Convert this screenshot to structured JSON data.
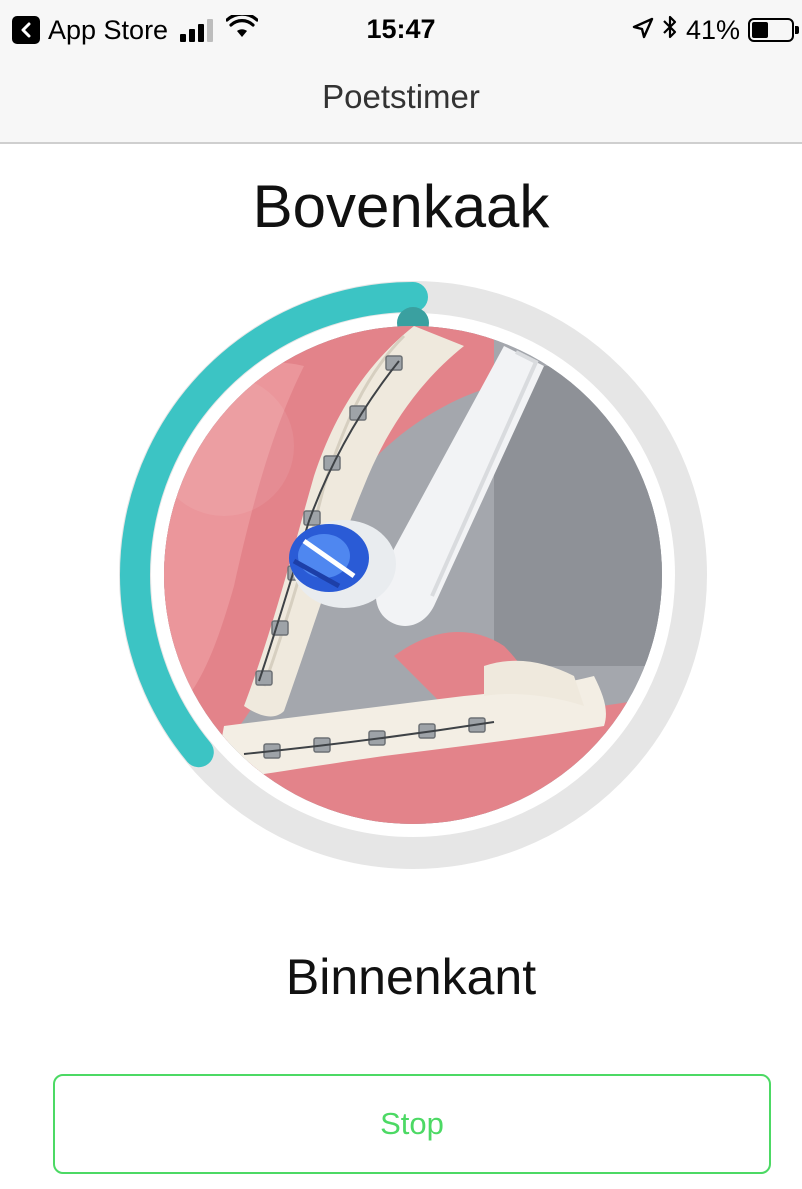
{
  "status_bar": {
    "back_app": "App Store",
    "time": "15:47",
    "battery": "41%",
    "battery_level": 0.41,
    "signal_bars": 3,
    "icons": [
      "back-arrow-icon",
      "signal-icon",
      "wifi-icon",
      "location-icon",
      "bluetooth-icon",
      "battery-icon"
    ]
  },
  "nav": {
    "title": "Poetstimer"
  },
  "timer": {
    "section_title": "Bovenkaak",
    "subtitle": "Binnenkant",
    "progress": 0.36,
    "colors": {
      "progress": "#3cc4c4",
      "knob": "#3aa0a0",
      "track": "#e6e6e6"
    }
  },
  "actions": {
    "stop_label": "Stop",
    "accent": "#4cd964"
  }
}
